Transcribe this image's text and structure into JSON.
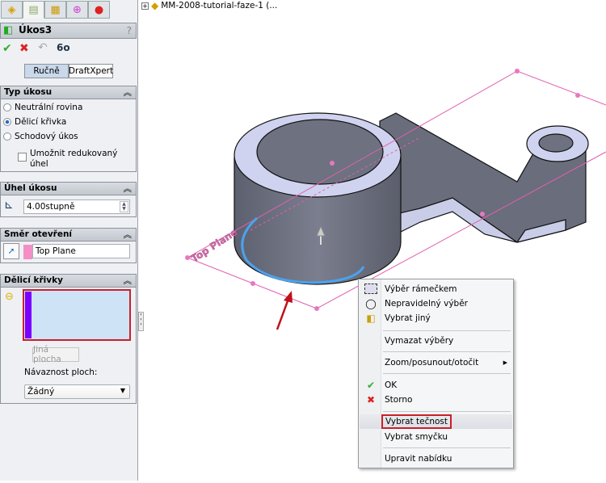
{
  "panel": {
    "tabs": [
      {
        "icon": "feature-manager-icon"
      },
      {
        "icon": "property-manager-icon"
      },
      {
        "icon": "configuration-manager-icon"
      },
      {
        "icon": "dimxpert-icon"
      },
      {
        "icon": "display-manager-icon"
      }
    ],
    "title": "Úkos3",
    "help": "?",
    "actions": {
      "ok": "✔",
      "cancel": "✖",
      "undo": "↶",
      "preview": "6o"
    },
    "mode_buttons": [
      "Ručně",
      "DraftXpert"
    ],
    "draft_type": {
      "header": "Typ úkosu",
      "options": [
        {
          "label": "Neutrální rovina",
          "selected": false
        },
        {
          "label": "Dělicí křivka",
          "selected": true
        },
        {
          "label": "Schodový úkos",
          "selected": false
        }
      ],
      "checkbox": {
        "label": "Umožnit redukovaný úhel",
        "checked": false
      }
    },
    "draft_angle": {
      "header": "Úhel úkosu",
      "value": "4.00stupně"
    },
    "pull_direction": {
      "header": "Směr otevření",
      "value": "Top Plane",
      "color": "#f48fc6"
    },
    "parting_lines": {
      "header": "Dělicí křivky",
      "list_color": "#cfe3f7",
      "marker_color": "#7a00ff",
      "other_face_button": "Jiná plocha",
      "tangent_label": "Návaznost ploch:",
      "tangent_value": "Žádný"
    }
  },
  "tree": {
    "root": "MM-2008-tutorial-faze-1  (..."
  },
  "viewport": {
    "plane_label": "Top Plane",
    "plane_color": "#e060b0",
    "edge_color": "#4aa3f0"
  },
  "context_menu": {
    "items": [
      {
        "label": "Výběr rámečkem",
        "icon": "box-select-icon"
      },
      {
        "label": "Nepravidelný výběr",
        "icon": "lasso-select-icon"
      },
      {
        "label": "Vybrat jiný",
        "icon": "select-other-icon"
      },
      {
        "label": "Vymazat výběry"
      },
      {
        "label": "Zoom/posunout/otočit",
        "submenu": true
      },
      {
        "label": "OK",
        "icon": "check-icon"
      },
      {
        "label": "Storno",
        "icon": "cancel-icon"
      },
      {
        "label": "Vybrat tečnost",
        "highlighted": true
      },
      {
        "label": "Vybrat smyčku"
      },
      {
        "label": "Upravit nabídku"
      }
    ]
  }
}
